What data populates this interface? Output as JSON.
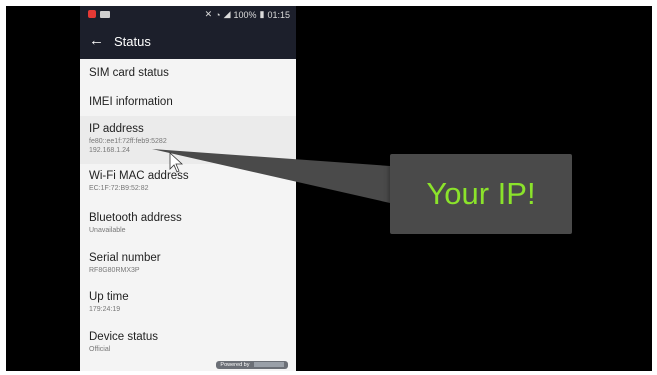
{
  "status_bar": {
    "time": "01:15",
    "battery": "100%"
  },
  "app_bar": {
    "back_icon": "arrow-back-icon",
    "title": "Status"
  },
  "list": [
    {
      "label": "SIM card status",
      "sub": []
    },
    {
      "label": "IMEI information",
      "sub": []
    },
    {
      "label": "IP address",
      "sub": [
        "fe80::ee1f:72ff:feb9:5282",
        "192.168.1.24"
      ]
    },
    {
      "label": "Wi-Fi MAC address",
      "sub": [
        "EC:1F:72:B9:52:82"
      ]
    },
    {
      "label": "Bluetooth address",
      "sub": [
        "Unavailable"
      ]
    },
    {
      "label": "Serial number",
      "sub": [
        "RF8G80RMX3P"
      ]
    },
    {
      "label": "Up time",
      "sub": [
        "179:24:19"
      ]
    },
    {
      "label": "Device status",
      "sub": [
        "Official"
      ]
    }
  ],
  "footer": {
    "text": "Powered by"
  },
  "callout": {
    "text": "Your IP!",
    "color": "#8be32b"
  },
  "colors": {
    "app_bar": "#1c1f2b",
    "background": "#000000"
  }
}
